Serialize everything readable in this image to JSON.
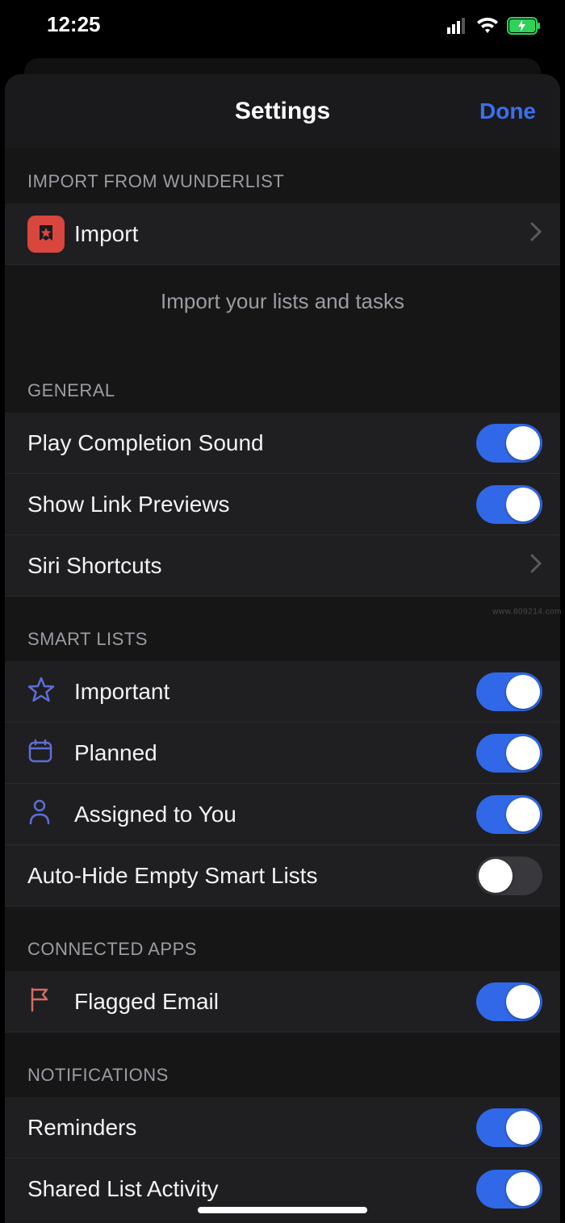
{
  "status": {
    "time": "12:25"
  },
  "header": {
    "title": "Settings",
    "done": "Done"
  },
  "sections": {
    "import": {
      "header": "IMPORT FROM WUNDERLIST",
      "item": "Import",
      "footer": "Import your lists and tasks"
    },
    "general": {
      "header": "GENERAL",
      "play_sound": "Play Completion Sound",
      "link_previews": "Show Link Previews",
      "siri": "Siri Shortcuts"
    },
    "smart": {
      "header": "SMART LISTS",
      "important": "Important",
      "planned": "Planned",
      "assigned": "Assigned to You",
      "autohide": "Auto-Hide Empty Smart Lists"
    },
    "connected": {
      "header": "CONNECTED APPS",
      "flagged": "Flagged Email"
    },
    "notifications": {
      "header": "NOTIFICATIONS",
      "reminders": "Reminders",
      "shared": "Shared List Activity"
    }
  },
  "toggles": {
    "play_sound": true,
    "link_previews": true,
    "important": true,
    "planned": true,
    "assigned": true,
    "autohide": false,
    "flagged": true,
    "reminders": true,
    "shared": true
  },
  "watermark": "www.809214.com"
}
